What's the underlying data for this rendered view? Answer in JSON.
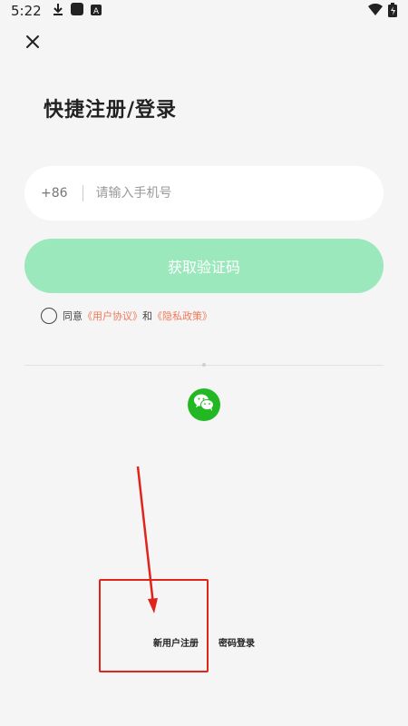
{
  "status_bar": {
    "time": "5:22",
    "icons": [
      "download-icon",
      "app-icon",
      "a-icon",
      "wifi-icon",
      "battery-icon"
    ]
  },
  "close_icon": "close-icon",
  "title": "快捷注册/登录",
  "phone": {
    "country_code": "+86",
    "placeholder": "请输入手机号",
    "value": ""
  },
  "code_button_label": "获取验证码",
  "agreement": {
    "prefix": "同意",
    "user_agreement": "《用户协议》",
    "and": "和",
    "privacy_policy": "《隐私政策》"
  },
  "third_party": {
    "icon": "wechat-icon"
  },
  "bottom_links": {
    "register": "新用户注册",
    "password_login": "密码登录"
  },
  "colors": {
    "background": "#f5f5f5",
    "button_disabled": "#9be8bd",
    "link": "#f07a5a",
    "wechat": "#22b823",
    "annotation": "#e0241b"
  }
}
